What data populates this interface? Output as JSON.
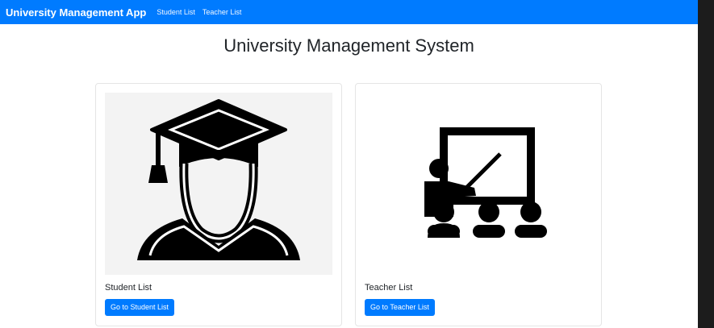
{
  "navbar": {
    "brand": "University Management App",
    "links": [
      "Student List",
      "Teacher List"
    ]
  },
  "main": {
    "title": "University Management System",
    "cards": [
      {
        "title": "Student List",
        "button_label": "Go to Student List",
        "image_icon": "graduate-student-icon"
      },
      {
        "title": "Teacher List",
        "button_label": "Go to Teacher List",
        "image_icon": "teacher-classroom-icon"
      }
    ]
  },
  "colors": {
    "primary": "#007bff",
    "text": "#212529",
    "card_border": "#e5e5e5"
  }
}
